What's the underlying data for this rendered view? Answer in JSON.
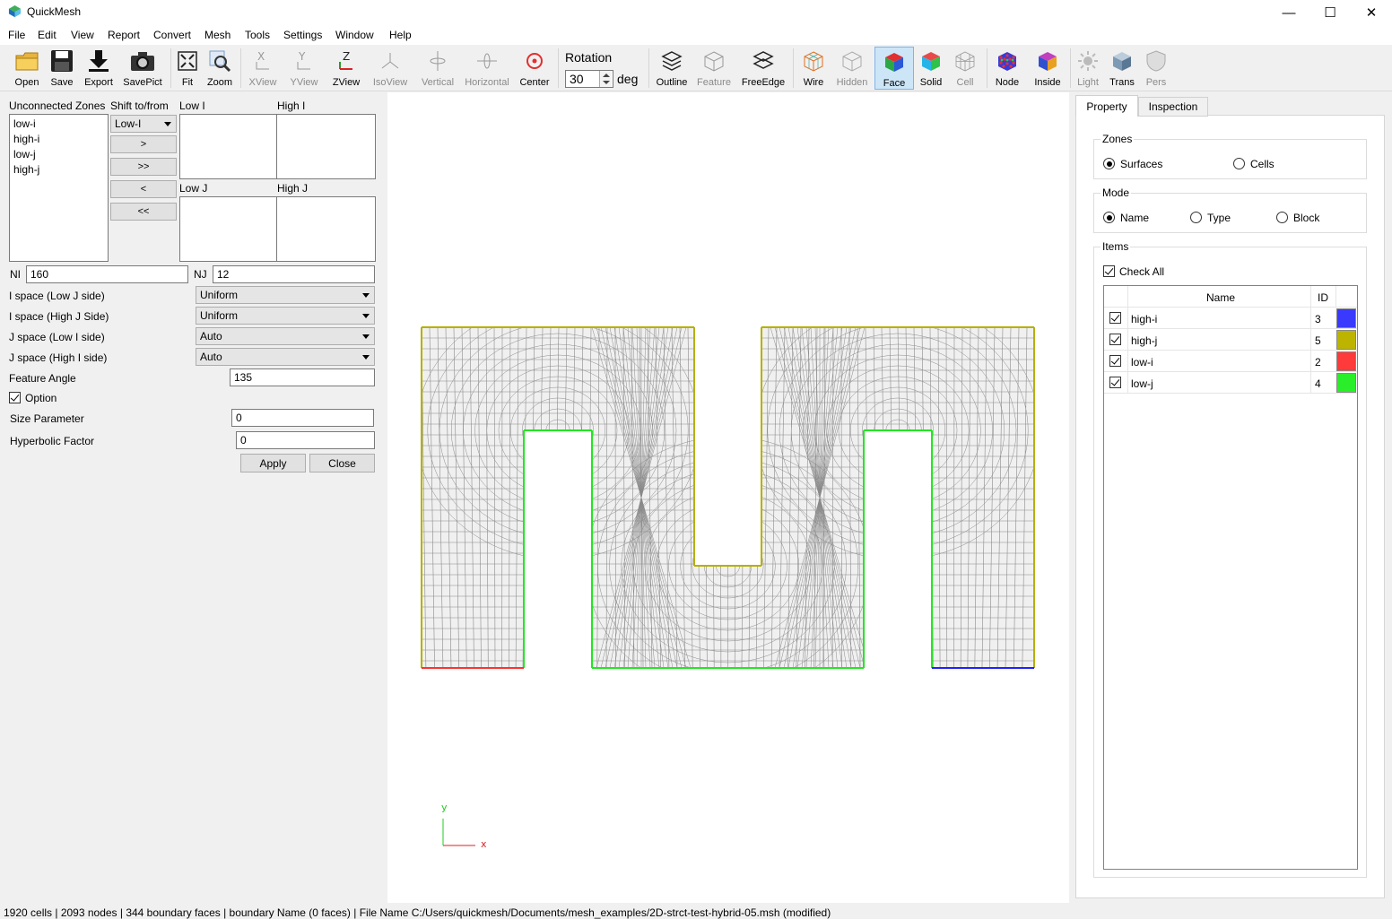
{
  "window": {
    "title": "QuickMesh",
    "minimize": "—",
    "maximize": "☐",
    "close": "✕"
  },
  "menu": [
    "File",
    "Edit",
    "View",
    "Report",
    "Convert",
    "Mesh",
    "Tools",
    "Settings",
    "Window",
    "Help"
  ],
  "toolbar": {
    "open": "Open",
    "save": "Save",
    "export": "Export",
    "savepict": "SavePict",
    "fit": "Fit",
    "zoom": "Zoom",
    "xview": "XView",
    "yview": "YView",
    "zview": "ZView",
    "isoview": "IsoView",
    "vertical": "Vertical",
    "horizontal": "Horizontal",
    "center": "Center",
    "rotation_label": "Rotation",
    "rotation_value": "30",
    "rotation_unit": "deg",
    "outline": "Outline",
    "feature": "Feature",
    "freeedge": "FreeEdge",
    "wire": "Wire",
    "hidden": "Hidden",
    "face": "Face",
    "solid": "Solid",
    "cell": "Cell",
    "node": "Node",
    "inside": "Inside",
    "light": "Light",
    "trans": "Trans",
    "pers": "Pers"
  },
  "left": {
    "unconnected_label": "Unconnected Zones",
    "shift_label": "Shift to/from",
    "zones": [
      "low-i",
      "high-i",
      "low-j",
      "high-j"
    ],
    "shift_combo": "Low-I",
    "btn_right": ">",
    "btn_right_all": ">>",
    "btn_left": "<",
    "btn_left_all": "<<",
    "low_i_label": "Low I",
    "high_i_label": "High I",
    "low_j_label": "Low J",
    "high_j_label": "High J",
    "ni_label": "NI",
    "ni_value": "160",
    "nj_label": "NJ",
    "nj_value": "12",
    "ispace_low_j_label": "I space (Low J side)",
    "ispace_low_j_value": "Uniform",
    "ispace_high_j_label": "I space (High J Side)",
    "ispace_high_j_value": "Uniform",
    "jspace_low_i_label": "J space (Low I side)",
    "jspace_low_i_value": "Auto",
    "jspace_high_i_label": "J space (High I side)",
    "jspace_high_i_value": "Auto",
    "feature_angle_label": "Feature Angle",
    "feature_angle_value": "135",
    "option_label": "Option",
    "size_param_label": "Size Parameter",
    "size_param_value": "0",
    "hyperbolic_label": "Hyperbolic Factor",
    "hyperbolic_value": "0",
    "apply": "Apply",
    "close": "Close"
  },
  "viewport": {
    "axis_x": "x",
    "axis_y": "y",
    "colors": {
      "high_j": "#b5b000",
      "low_j": "#22e622",
      "low_i": "#ff3030",
      "high_i": "#2020ff",
      "grid": "#8a8a8a",
      "fill": "#f0f0f0"
    }
  },
  "right": {
    "tab_property": "Property",
    "tab_inspection": "Inspection",
    "zones_label": "Zones",
    "surfaces": "Surfaces",
    "cells": "Cells",
    "mode_label": "Mode",
    "mode_name": "Name",
    "mode_type": "Type",
    "mode_block": "Block",
    "items_label": "Items",
    "check_all": "Check All",
    "col_name": "Name",
    "col_id": "ID",
    "rows": [
      {
        "name": "high-i",
        "id": "3",
        "color": "#3a3aff"
      },
      {
        "name": "high-j",
        "id": "5",
        "color": "#bdb400"
      },
      {
        "name": "low-i",
        "id": "2",
        "color": "#ff3a3a"
      },
      {
        "name": "low-j",
        "id": "4",
        "color": "#2aee2a"
      }
    ]
  },
  "status": "1920 cells | 2093 nodes | 344 boundary faces |  boundary Name  (0 faces) | File Name C:/Users/quickmesh/Documents/mesh_examples/2D-strct-test-hybrid-05.msh (modified)"
}
